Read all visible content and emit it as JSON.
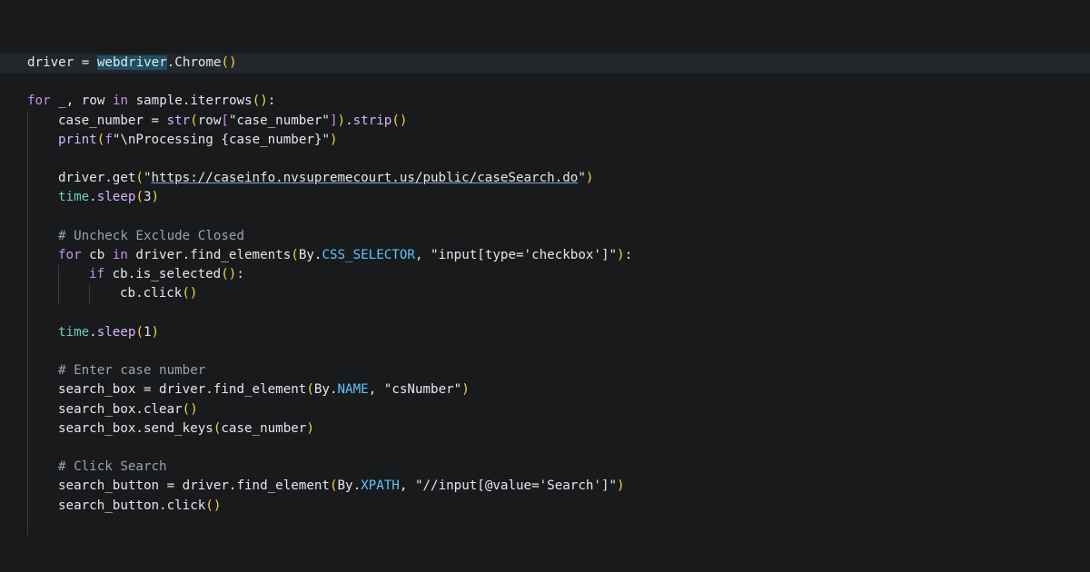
{
  "code": [
    {
      "indent": 0,
      "current": true,
      "tokens": [
        {
          "t": "driver = "
        },
        {
          "t": "webdriver",
          "c": "sel"
        },
        {
          "t": ".Chrome"
        },
        {
          "t": "()",
          "c": "br"
        }
      ]
    },
    {
      "indent": 0,
      "tokens": []
    },
    {
      "indent": 0,
      "tokens": [
        {
          "t": "for",
          "c": "kw"
        },
        {
          "t": " _, row "
        },
        {
          "t": "in",
          "c": "kw"
        },
        {
          "t": " sample.iterrows"
        },
        {
          "t": "()",
          "c": "br"
        },
        {
          "t": ":"
        }
      ]
    },
    {
      "indent": 1,
      "tokens": [
        {
          "t": "case_number = "
        },
        {
          "t": "str",
          "c": "fn"
        },
        {
          "t": "(",
          "c": "br"
        },
        {
          "t": "row"
        },
        {
          "t": "[",
          "c": "br2"
        },
        {
          "t": "\"case_number\"",
          "c": "str"
        },
        {
          "t": "]",
          "c": "br2"
        },
        {
          "t": ")",
          "c": "br"
        },
        {
          "t": "."
        },
        {
          "t": "strip",
          "c": "fn"
        },
        {
          "t": "()",
          "c": "br"
        }
      ]
    },
    {
      "indent": 1,
      "tokens": [
        {
          "t": "print",
          "c": "fn"
        },
        {
          "t": "(",
          "c": "br"
        },
        {
          "t": "f",
          "c": "kw"
        },
        {
          "t": "\"\\nProcessing "
        },
        {
          "t": "{"
        },
        {
          "t": "case_number"
        },
        {
          "t": "}\""
        },
        {
          "t": ")",
          "c": "br"
        }
      ]
    },
    {
      "indent": 0,
      "tokens": []
    },
    {
      "indent": 1,
      "tokens": [
        {
          "t": "driver.get"
        },
        {
          "t": "(",
          "c": "br"
        },
        {
          "t": "\""
        },
        {
          "t": "https://caseinfo.nvsupremecourt.us/public/caseSearch.do",
          "c": "url"
        },
        {
          "t": "\""
        },
        {
          "t": ")",
          "c": "br"
        }
      ]
    },
    {
      "indent": 1,
      "tokens": [
        {
          "t": "time",
          "c": "mod"
        },
        {
          "t": "."
        },
        {
          "t": "sleep",
          "c": "fn"
        },
        {
          "t": "(",
          "c": "br"
        },
        {
          "t": "3",
          "c": "num"
        },
        {
          "t": ")",
          "c": "br"
        }
      ]
    },
    {
      "indent": 0,
      "tokens": []
    },
    {
      "indent": 1,
      "tokens": [
        {
          "t": "# Uncheck Exclude Closed",
          "c": "cm"
        }
      ]
    },
    {
      "indent": 1,
      "tokens": [
        {
          "t": "for",
          "c": "kw"
        },
        {
          "t": " cb "
        },
        {
          "t": "in",
          "c": "kw"
        },
        {
          "t": " driver.find_elements"
        },
        {
          "t": "(",
          "c": "br"
        },
        {
          "t": "By."
        },
        {
          "t": "CSS_SELECTOR",
          "c": "const"
        },
        {
          "t": ", "
        },
        {
          "t": "\"input[type='checkbox']\"",
          "c": "str"
        },
        {
          "t": ")",
          "c": "br"
        },
        {
          "t": ":"
        }
      ]
    },
    {
      "indent": 2,
      "tokens": [
        {
          "t": "if",
          "c": "kw"
        },
        {
          "t": " cb.is_selected"
        },
        {
          "t": "()",
          "c": "br"
        },
        {
          "t": ":"
        }
      ]
    },
    {
      "indent": 3,
      "tokens": [
        {
          "t": "cb.click"
        },
        {
          "t": "()",
          "c": "br"
        }
      ]
    },
    {
      "indent": 0,
      "tokens": []
    },
    {
      "indent": 1,
      "tokens": [
        {
          "t": "time",
          "c": "mod"
        },
        {
          "t": "."
        },
        {
          "t": "sleep",
          "c": "fn"
        },
        {
          "t": "(",
          "c": "br"
        },
        {
          "t": "1",
          "c": "num"
        },
        {
          "t": ")",
          "c": "br"
        }
      ]
    },
    {
      "indent": 0,
      "tokens": []
    },
    {
      "indent": 1,
      "tokens": [
        {
          "t": "# Enter case number",
          "c": "cm"
        }
      ]
    },
    {
      "indent": 1,
      "tokens": [
        {
          "t": "search_box = driver.find_element"
        },
        {
          "t": "(",
          "c": "br"
        },
        {
          "t": "By."
        },
        {
          "t": "NAME",
          "c": "const"
        },
        {
          "t": ", "
        },
        {
          "t": "\"csNumber\"",
          "c": "str"
        },
        {
          "t": ")",
          "c": "br"
        }
      ]
    },
    {
      "indent": 1,
      "tokens": [
        {
          "t": "search_box.clear"
        },
        {
          "t": "()",
          "c": "br"
        }
      ]
    },
    {
      "indent": 1,
      "tokens": [
        {
          "t": "search_box.send_keys"
        },
        {
          "t": "(",
          "c": "br"
        },
        {
          "t": "case_number"
        },
        {
          "t": ")",
          "c": "br"
        }
      ]
    },
    {
      "indent": 0,
      "tokens": []
    },
    {
      "indent": 1,
      "tokens": [
        {
          "t": "# Click Search",
          "c": "cm"
        }
      ]
    },
    {
      "indent": 1,
      "tokens": [
        {
          "t": "search_button = driver.find_element"
        },
        {
          "t": "(",
          "c": "br"
        },
        {
          "t": "By."
        },
        {
          "t": "XPATH",
          "c": "const"
        },
        {
          "t": ", "
        },
        {
          "t": "\"//input[@value='Search']\"",
          "c": "str"
        },
        {
          "t": ")",
          "c": "br"
        }
      ]
    },
    {
      "indent": 1,
      "tokens": [
        {
          "t": "search_button.click"
        },
        {
          "t": "()",
          "c": "br"
        }
      ]
    }
  ]
}
